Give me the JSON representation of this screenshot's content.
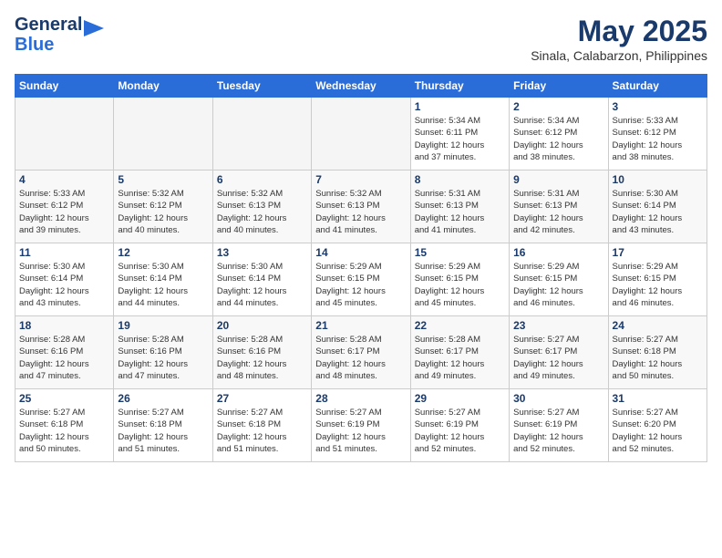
{
  "header": {
    "logo_line1": "General",
    "logo_line2": "Blue",
    "month": "May 2025",
    "location": "Sinala, Calabarzon, Philippines"
  },
  "days_of_week": [
    "Sunday",
    "Monday",
    "Tuesday",
    "Wednesday",
    "Thursday",
    "Friday",
    "Saturday"
  ],
  "weeks": [
    [
      {
        "day": "",
        "info": ""
      },
      {
        "day": "",
        "info": ""
      },
      {
        "day": "",
        "info": ""
      },
      {
        "day": "",
        "info": ""
      },
      {
        "day": "1",
        "info": "Sunrise: 5:34 AM\nSunset: 6:11 PM\nDaylight: 12 hours\nand 37 minutes."
      },
      {
        "day": "2",
        "info": "Sunrise: 5:34 AM\nSunset: 6:12 PM\nDaylight: 12 hours\nand 38 minutes."
      },
      {
        "day": "3",
        "info": "Sunrise: 5:33 AM\nSunset: 6:12 PM\nDaylight: 12 hours\nand 38 minutes."
      }
    ],
    [
      {
        "day": "4",
        "info": "Sunrise: 5:33 AM\nSunset: 6:12 PM\nDaylight: 12 hours\nand 39 minutes."
      },
      {
        "day": "5",
        "info": "Sunrise: 5:32 AM\nSunset: 6:12 PM\nDaylight: 12 hours\nand 40 minutes."
      },
      {
        "day": "6",
        "info": "Sunrise: 5:32 AM\nSunset: 6:13 PM\nDaylight: 12 hours\nand 40 minutes."
      },
      {
        "day": "7",
        "info": "Sunrise: 5:32 AM\nSunset: 6:13 PM\nDaylight: 12 hours\nand 41 minutes."
      },
      {
        "day": "8",
        "info": "Sunrise: 5:31 AM\nSunset: 6:13 PM\nDaylight: 12 hours\nand 41 minutes."
      },
      {
        "day": "9",
        "info": "Sunrise: 5:31 AM\nSunset: 6:13 PM\nDaylight: 12 hours\nand 42 minutes."
      },
      {
        "day": "10",
        "info": "Sunrise: 5:30 AM\nSunset: 6:14 PM\nDaylight: 12 hours\nand 43 minutes."
      }
    ],
    [
      {
        "day": "11",
        "info": "Sunrise: 5:30 AM\nSunset: 6:14 PM\nDaylight: 12 hours\nand 43 minutes."
      },
      {
        "day": "12",
        "info": "Sunrise: 5:30 AM\nSunset: 6:14 PM\nDaylight: 12 hours\nand 44 minutes."
      },
      {
        "day": "13",
        "info": "Sunrise: 5:30 AM\nSunset: 6:14 PM\nDaylight: 12 hours\nand 44 minutes."
      },
      {
        "day": "14",
        "info": "Sunrise: 5:29 AM\nSunset: 6:15 PM\nDaylight: 12 hours\nand 45 minutes."
      },
      {
        "day": "15",
        "info": "Sunrise: 5:29 AM\nSunset: 6:15 PM\nDaylight: 12 hours\nand 45 minutes."
      },
      {
        "day": "16",
        "info": "Sunrise: 5:29 AM\nSunset: 6:15 PM\nDaylight: 12 hours\nand 46 minutes."
      },
      {
        "day": "17",
        "info": "Sunrise: 5:29 AM\nSunset: 6:15 PM\nDaylight: 12 hours\nand 46 minutes."
      }
    ],
    [
      {
        "day": "18",
        "info": "Sunrise: 5:28 AM\nSunset: 6:16 PM\nDaylight: 12 hours\nand 47 minutes."
      },
      {
        "day": "19",
        "info": "Sunrise: 5:28 AM\nSunset: 6:16 PM\nDaylight: 12 hours\nand 47 minutes."
      },
      {
        "day": "20",
        "info": "Sunrise: 5:28 AM\nSunset: 6:16 PM\nDaylight: 12 hours\nand 48 minutes."
      },
      {
        "day": "21",
        "info": "Sunrise: 5:28 AM\nSunset: 6:17 PM\nDaylight: 12 hours\nand 48 minutes."
      },
      {
        "day": "22",
        "info": "Sunrise: 5:28 AM\nSunset: 6:17 PM\nDaylight: 12 hours\nand 49 minutes."
      },
      {
        "day": "23",
        "info": "Sunrise: 5:27 AM\nSunset: 6:17 PM\nDaylight: 12 hours\nand 49 minutes."
      },
      {
        "day": "24",
        "info": "Sunrise: 5:27 AM\nSunset: 6:18 PM\nDaylight: 12 hours\nand 50 minutes."
      }
    ],
    [
      {
        "day": "25",
        "info": "Sunrise: 5:27 AM\nSunset: 6:18 PM\nDaylight: 12 hours\nand 50 minutes."
      },
      {
        "day": "26",
        "info": "Sunrise: 5:27 AM\nSunset: 6:18 PM\nDaylight: 12 hours\nand 51 minutes."
      },
      {
        "day": "27",
        "info": "Sunrise: 5:27 AM\nSunset: 6:18 PM\nDaylight: 12 hours\nand 51 minutes."
      },
      {
        "day": "28",
        "info": "Sunrise: 5:27 AM\nSunset: 6:19 PM\nDaylight: 12 hours\nand 51 minutes."
      },
      {
        "day": "29",
        "info": "Sunrise: 5:27 AM\nSunset: 6:19 PM\nDaylight: 12 hours\nand 52 minutes."
      },
      {
        "day": "30",
        "info": "Sunrise: 5:27 AM\nSunset: 6:19 PM\nDaylight: 12 hours\nand 52 minutes."
      },
      {
        "day": "31",
        "info": "Sunrise: 5:27 AM\nSunset: 6:20 PM\nDaylight: 12 hours\nand 52 minutes."
      }
    ]
  ]
}
